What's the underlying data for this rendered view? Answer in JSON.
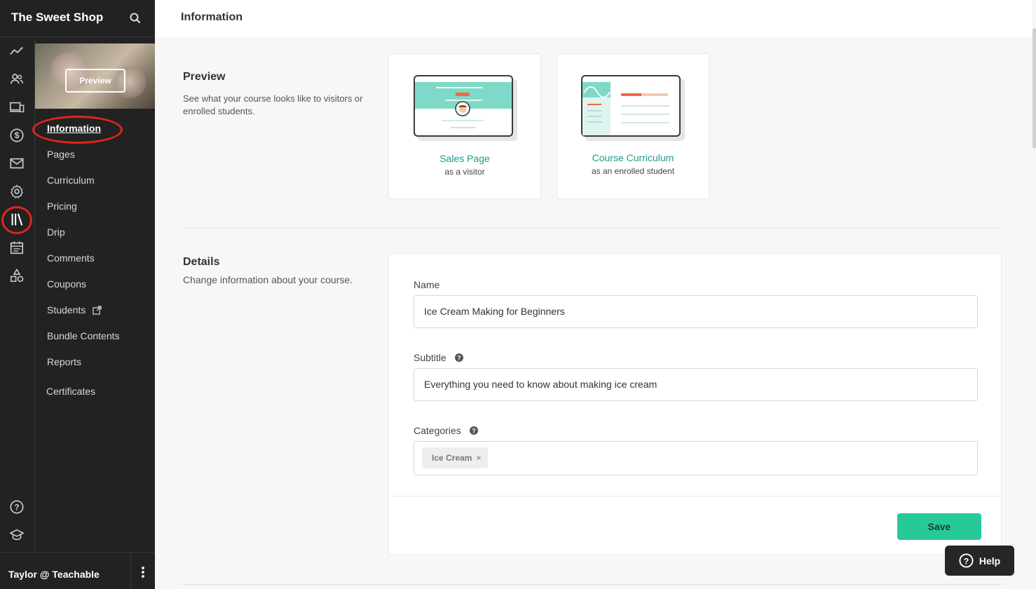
{
  "brand": {
    "name": "The Sweet Shop",
    "search_icon": "search-icon"
  },
  "rail": {
    "icons": [
      "analytics-icon",
      "users-icon",
      "devices-icon",
      "dollar-icon",
      "mail-icon",
      "gear-icon",
      "library-icon",
      "calendar-icon",
      "shapes-icon",
      "help-circle-icon",
      "graduation-cap-icon"
    ]
  },
  "course_nav": {
    "preview_label": "Preview",
    "items": [
      {
        "label": "Information",
        "active": true
      },
      {
        "label": "Pages"
      },
      {
        "label": "Curriculum"
      },
      {
        "label": "Pricing"
      },
      {
        "label": "Drip"
      },
      {
        "label": "Comments"
      },
      {
        "label": "Coupons"
      },
      {
        "label": "Students",
        "icon": "external-link-icon"
      },
      {
        "label": "Bundle Contents"
      },
      {
        "label": "Reports"
      },
      {
        "label": "Certificates"
      }
    ]
  },
  "user": {
    "name": "Taylor @ Teachable",
    "menu_icon": "kebab-menu-icon"
  },
  "header": {
    "title": "Information"
  },
  "preview_section": {
    "title": "Preview",
    "description": "See what your course looks like to visitors or enrolled students.",
    "cards": [
      {
        "title": "Sales Page",
        "subtitle": "as a visitor"
      },
      {
        "title": "Course Curriculum",
        "subtitle": "as an enrolled student"
      }
    ]
  },
  "details_section": {
    "title": "Details",
    "description": "Change information about your course.",
    "name_label": "Name",
    "name_value": "Ice Cream Making for Beginners",
    "subtitle_label": "Subtitle",
    "subtitle_value": "Everything you need to know about making ice cream",
    "categories_label": "Categories",
    "categories": [
      "Ice Cream"
    ],
    "tag_remove": "×",
    "save_label": "Save"
  },
  "help": {
    "label": "Help"
  },
  "colors": {
    "accent": "#1a9c8c",
    "save": "#27c99b",
    "annotation": "#e2231a",
    "sidebar": "#222222"
  }
}
